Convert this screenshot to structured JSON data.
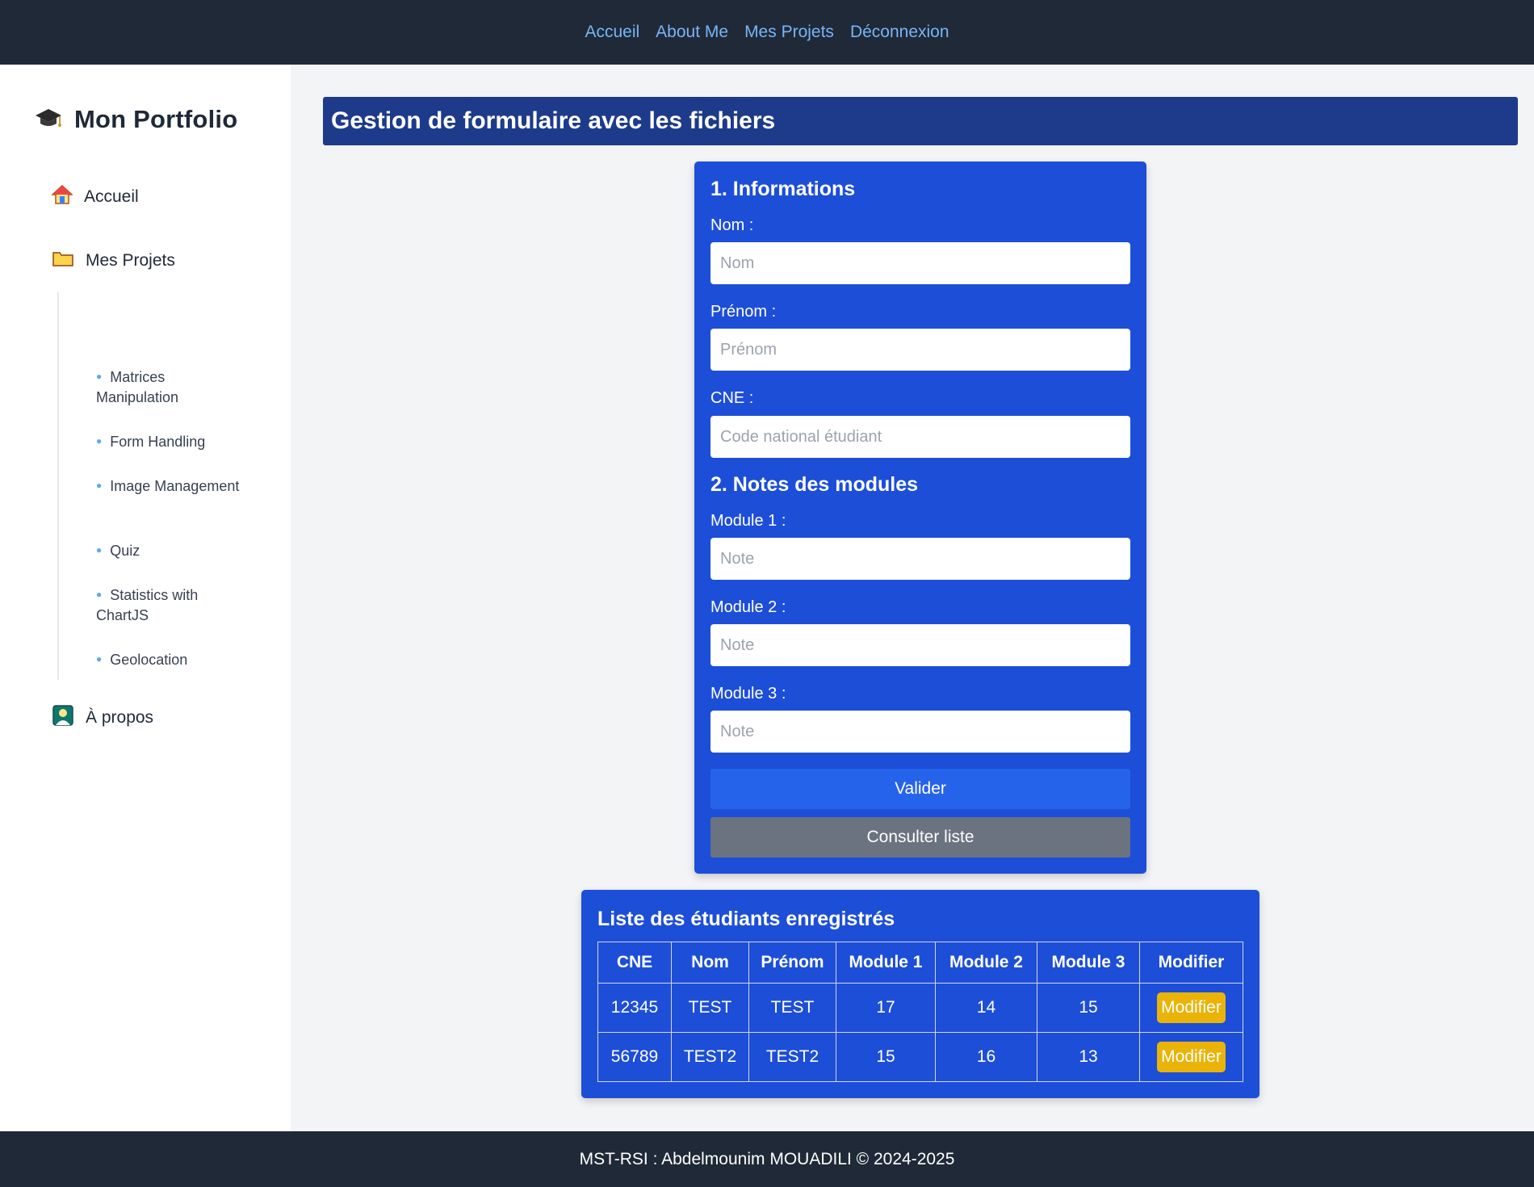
{
  "nav": {
    "links": [
      "Accueil",
      "About Me",
      "Mes Projets",
      "Déconnexion"
    ]
  },
  "sidebar": {
    "brand": "Mon Portfolio",
    "brand_icon": "graduation-cap-icon",
    "items": {
      "home": {
        "label": "Accueil",
        "icon": "house-icon"
      },
      "projects": {
        "label": "Mes Projets",
        "icon": "folder-icon"
      },
      "about": {
        "label": "À propos",
        "icon": "portrait-icon"
      }
    },
    "projects": [
      "Matrices Manipulation",
      "Form Handling",
      "Image Management",
      "Quiz",
      "Statistics with ChartJS",
      "Geolocation"
    ]
  },
  "page": {
    "title": "Gestion de formulaire avec les fichiers"
  },
  "form": {
    "section1": "1. Informations",
    "nom_label": "Nom :",
    "nom_placeholder": "Nom",
    "prenom_label": "Prénom :",
    "prenom_placeholder": "Prénom",
    "cne_label": "CNE :",
    "cne_placeholder": "Code national étudiant",
    "section2": "2. Notes des modules",
    "module1_label": "Module 1 :",
    "module2_label": "Module 2 :",
    "module3_label": "Module 3 :",
    "note_placeholder": "Note",
    "submit_label": "Valider",
    "list_label": "Consulter liste"
  },
  "students": {
    "title": "Liste des étudiants enregistrés",
    "headers": [
      "CNE",
      "Nom",
      "Prénom",
      "Module 1",
      "Module 2",
      "Module 3",
      "Modifier"
    ],
    "rows": [
      {
        "cne": "12345",
        "nom": "TEST",
        "prenom": "TEST",
        "m1": "17",
        "m2": "14",
        "m3": "15",
        "action": "Modifier"
      },
      {
        "cne": "56789",
        "nom": "TEST2",
        "prenom": "TEST2",
        "m1": "15",
        "m2": "16",
        "m3": "13",
        "action": "Modifier"
      }
    ]
  },
  "footer": {
    "text": "MST-RSI : Abdelmounim MOUADILI © 2024-2025"
  },
  "colors": {
    "header_bg": "#1f2937",
    "nav_link": "#7ab4f5",
    "title_bar": "#1e3a8a",
    "card_bg": "#1d4ed8",
    "primary_button": "#2563eb",
    "secondary_button": "#6b7280",
    "edit_button": "#eab308",
    "page_bg": "#f3f4f6"
  }
}
